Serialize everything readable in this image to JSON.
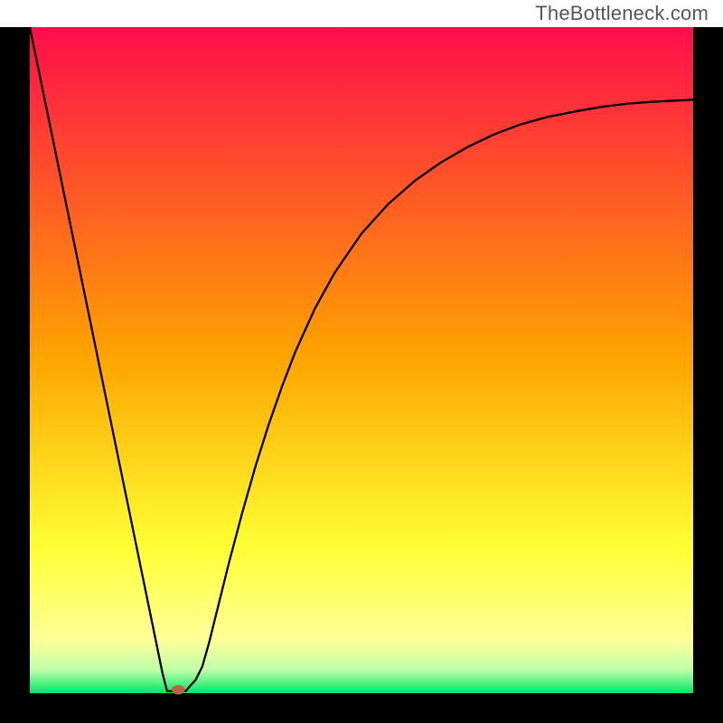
{
  "attribution": "TheBottleneck.com",
  "chart_data": {
    "type": "line",
    "title": "",
    "xlabel": "",
    "ylabel": "",
    "xlim": [
      0,
      100
    ],
    "ylim": [
      0,
      100
    ],
    "background": {
      "type": "vertical_gradient",
      "stops": [
        {
          "pos": 0.0,
          "color": "#ff0d4b"
        },
        {
          "pos": 0.5,
          "color": "#ffa500"
        },
        {
          "pos": 0.78,
          "color": "#ffff33"
        },
        {
          "pos": 0.92,
          "color": "#ffff99"
        },
        {
          "pos": 0.965,
          "color": "#bfffa8"
        },
        {
          "pos": 1.0,
          "color": "#00e765"
        }
      ]
    },
    "frame": {
      "left": true,
      "right": true,
      "top": false,
      "bottom": true,
      "color": "#000000"
    },
    "series": [
      {
        "name": "bottleneck-curve",
        "color": "#000000",
        "stroke_width": 2.3,
        "x": [
          0.0,
          2.0,
          4.0,
          6.0,
          8.0,
          10.0,
          12.0,
          14.0,
          16.0,
          18.0,
          20.0,
          20.7,
          21.4,
          23.5,
          24.0,
          25.0,
          26.0,
          27.0,
          28.0,
          30.0,
          32.0,
          34.0,
          36.0,
          38.0,
          40.0,
          43.0,
          46.0,
          50.0,
          54.0,
          58.0,
          62.0,
          66.0,
          70.0,
          74.0,
          78.0,
          82.0,
          86.0,
          90.0,
          94.0,
          98.0,
          100.0
        ],
        "y": [
          100.0,
          90.3,
          80.6,
          70.9,
          61.2,
          51.5,
          41.8,
          32.1,
          22.4,
          12.7,
          3.0,
          0.3,
          0.3,
          0.3,
          0.9,
          2.0,
          4.0,
          7.5,
          11.5,
          19.5,
          27.0,
          34.0,
          40.3,
          46.0,
          51.2,
          57.8,
          63.2,
          69.0,
          73.4,
          76.9,
          79.7,
          82.0,
          83.9,
          85.4,
          86.5,
          87.3,
          88.0,
          88.5,
          88.8,
          89.0,
          89.1
        ]
      }
    ],
    "marker": {
      "name": "optimal-point",
      "x": 22.4,
      "y": 0.5,
      "rx": 1.0,
      "ry": 0.7,
      "color": "#c75a4a"
    }
  }
}
